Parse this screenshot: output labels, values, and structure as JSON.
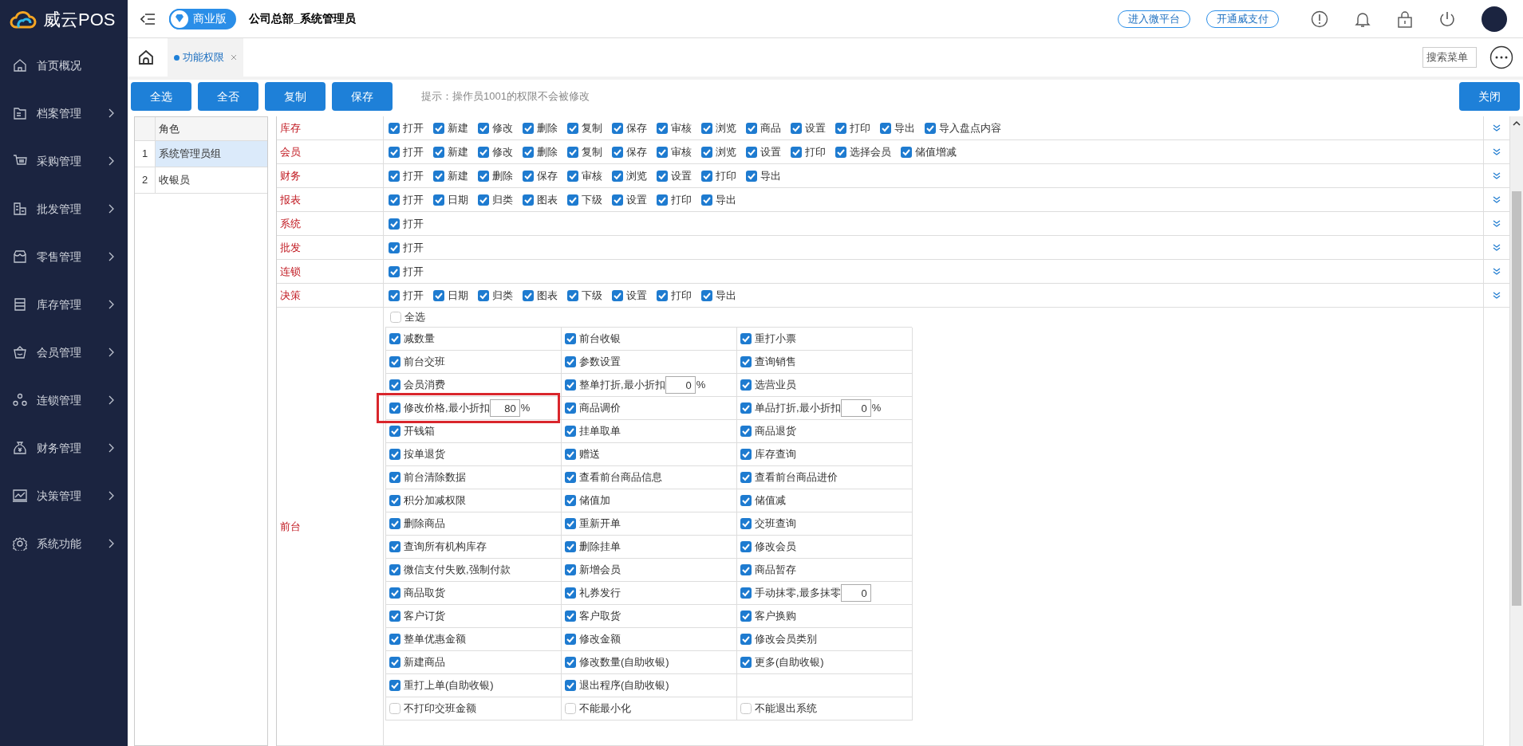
{
  "app": {
    "logo_text": "威云POS"
  },
  "sidebar": {
    "items": [
      {
        "label": "首页概况",
        "kind": "page"
      },
      {
        "label": "档案管理",
        "kind": "group"
      },
      {
        "label": "采购管理",
        "kind": "group"
      },
      {
        "label": "批发管理",
        "kind": "group"
      },
      {
        "label": "零售管理",
        "kind": "group"
      },
      {
        "label": "库存管理",
        "kind": "group"
      },
      {
        "label": "会员管理",
        "kind": "group"
      },
      {
        "label": "连锁管理",
        "kind": "group"
      },
      {
        "label": "财务管理",
        "kind": "group"
      },
      {
        "label": "决策管理",
        "kind": "group"
      },
      {
        "label": "系统功能",
        "kind": "group"
      }
    ]
  },
  "header": {
    "edition": "商业版",
    "company": "公司总部_系统管理员",
    "links": [
      "进入微平台",
      "开通威支付"
    ]
  },
  "tabs": [
    {
      "label": "功能权限",
      "selected": true
    }
  ],
  "search": {
    "placeholder": "搜索菜单"
  },
  "toolbar": {
    "buttons": [
      "全选",
      "全否",
      "复制",
      "保存"
    ],
    "hint": "提示：操作员1001的权限不会被修改",
    "close": "关闭"
  },
  "roles": {
    "column": "角色",
    "rows": [
      {
        "index": "1",
        "name": "系统管理员组",
        "selected": true
      },
      {
        "index": "2",
        "name": "收银员",
        "selected": false
      }
    ]
  },
  "modules": [
    {
      "name": "库存",
      "permissions": [
        {
          "label": "打开",
          "checked": true
        },
        {
          "label": "新建",
          "checked": true
        },
        {
          "label": "修改",
          "checked": true
        },
        {
          "label": "删除",
          "checked": true
        },
        {
          "label": "复制",
          "checked": true
        },
        {
          "label": "保存",
          "checked": true
        },
        {
          "label": "审核",
          "checked": true
        },
        {
          "label": "浏览",
          "checked": true
        },
        {
          "label": "商品",
          "checked": true
        },
        {
          "label": "设置",
          "checked": true
        },
        {
          "label": "打印",
          "checked": true
        },
        {
          "label": "导出",
          "checked": true
        },
        {
          "label": "导入盘点内容",
          "checked": true
        }
      ]
    },
    {
      "name": "会员",
      "permissions": [
        {
          "label": "打开",
          "checked": true
        },
        {
          "label": "新建",
          "checked": true
        },
        {
          "label": "修改",
          "checked": true
        },
        {
          "label": "删除",
          "checked": true
        },
        {
          "label": "复制",
          "checked": true
        },
        {
          "label": "保存",
          "checked": true
        },
        {
          "label": "审核",
          "checked": true
        },
        {
          "label": "浏览",
          "checked": true
        },
        {
          "label": "设置",
          "checked": true
        },
        {
          "label": "打印",
          "checked": true
        },
        {
          "label": "选择会员",
          "checked": true
        },
        {
          "label": "储值增减",
          "checked": true
        }
      ]
    },
    {
      "name": "财务",
      "permissions": [
        {
          "label": "打开",
          "checked": true
        },
        {
          "label": "新建",
          "checked": true
        },
        {
          "label": "删除",
          "checked": true
        },
        {
          "label": "保存",
          "checked": true
        },
        {
          "label": "审核",
          "checked": true
        },
        {
          "label": "浏览",
          "checked": true
        },
        {
          "label": "设置",
          "checked": true
        },
        {
          "label": "打印",
          "checked": true
        },
        {
          "label": "导出",
          "checked": true
        }
      ]
    },
    {
      "name": "报表",
      "permissions": [
        {
          "label": "打开",
          "checked": true
        },
        {
          "label": "日期",
          "checked": true
        },
        {
          "label": "归类",
          "checked": true
        },
        {
          "label": "图表",
          "checked": true
        },
        {
          "label": "下级",
          "checked": true
        },
        {
          "label": "设置",
          "checked": true
        },
        {
          "label": "打印",
          "checked": true
        },
        {
          "label": "导出",
          "checked": true
        }
      ]
    },
    {
      "name": "系统",
      "permissions": [
        {
          "label": "打开",
          "checked": true
        }
      ]
    },
    {
      "name": "批发",
      "permissions": [
        {
          "label": "打开",
          "checked": true
        }
      ]
    },
    {
      "name": "连锁",
      "permissions": [
        {
          "label": "打开",
          "checked": true
        }
      ]
    },
    {
      "name": "决策",
      "permissions": [
        {
          "label": "打开",
          "checked": true
        },
        {
          "label": "日期",
          "checked": true
        },
        {
          "label": "归类",
          "checked": true
        },
        {
          "label": "图表",
          "checked": true
        },
        {
          "label": "下级",
          "checked": true
        },
        {
          "label": "设置",
          "checked": true
        },
        {
          "label": "打印",
          "checked": true
        },
        {
          "label": "导出",
          "checked": true
        }
      ]
    }
  ],
  "frontdesk": {
    "name": "前台",
    "select_all": {
      "label": "全选",
      "checked": false
    },
    "items": [
      {
        "label": "减数量",
        "checked": true
      },
      {
        "label": "前台收银",
        "checked": true
      },
      {
        "label": "重打小票",
        "checked": true
      },
      {
        "label": "前台交班",
        "checked": true
      },
      {
        "label": "参数设置",
        "checked": true
      },
      {
        "label": "查询销售",
        "checked": true
      },
      {
        "label": "会员消费",
        "checked": true
      },
      {
        "label": "整单打折,最小折扣",
        "checked": true,
        "value": "0",
        "suffix": "%"
      },
      {
        "label": "选营业员",
        "checked": true
      },
      {
        "label": "修改价格,最小折扣",
        "checked": true,
        "value": "80",
        "suffix": "%",
        "highlighted": true
      },
      {
        "label": "商品调价",
        "checked": true
      },
      {
        "label": "单品打折,最小折扣",
        "checked": true,
        "value": "0",
        "suffix": "%"
      },
      {
        "label": "开钱箱",
        "checked": true
      },
      {
        "label": "挂单取单",
        "checked": true
      },
      {
        "label": "商品退货",
        "checked": true
      },
      {
        "label": "按单退货",
        "checked": true
      },
      {
        "label": "赠送",
        "checked": true
      },
      {
        "label": "库存查询",
        "checked": true
      },
      {
        "label": "前台清除数据",
        "checked": true
      },
      {
        "label": "查看前台商品信息",
        "checked": true
      },
      {
        "label": "查看前台商品进价",
        "checked": true
      },
      {
        "label": "积分加减权限",
        "checked": true
      },
      {
        "label": "储值加",
        "checked": true
      },
      {
        "label": "储值减",
        "checked": true
      },
      {
        "label": "删除商品",
        "checked": true
      },
      {
        "label": "重新开单",
        "checked": true
      },
      {
        "label": "交班查询",
        "checked": true
      },
      {
        "label": "查询所有机构库存",
        "checked": true
      },
      {
        "label": "删除挂单",
        "checked": true
      },
      {
        "label": "修改会员",
        "checked": true
      },
      {
        "label": "微信支付失败,强制付款",
        "checked": true
      },
      {
        "label": "新增会员",
        "checked": true
      },
      {
        "label": "商品暂存",
        "checked": true
      },
      {
        "label": "商品取货",
        "checked": true
      },
      {
        "label": "礼券发行",
        "checked": true
      },
      {
        "label": "手动抹零,最多抹零",
        "checked": true,
        "value": "0"
      },
      {
        "label": "客户订货",
        "checked": true
      },
      {
        "label": "客户取货",
        "checked": true
      },
      {
        "label": "客户换购",
        "checked": true
      },
      {
        "label": "整单优惠金额",
        "checked": true
      },
      {
        "label": "修改金额",
        "checked": true
      },
      {
        "label": "修改会员类别",
        "checked": true
      },
      {
        "label": "新建商品",
        "checked": true
      },
      {
        "label": "修改数量(自助收银)",
        "checked": true
      },
      {
        "label": "更多(自助收银)",
        "checked": true
      },
      {
        "label": "重打上单(自助收银)",
        "checked": true
      },
      {
        "label": "退出程序(自助收银)",
        "checked": true
      },
      {
        "kind": "empty"
      },
      {
        "label": "不打印交班金额",
        "checked": false
      },
      {
        "label": "不能最小化",
        "checked": false
      },
      {
        "label": "不能退出系统",
        "checked": false
      }
    ]
  }
}
